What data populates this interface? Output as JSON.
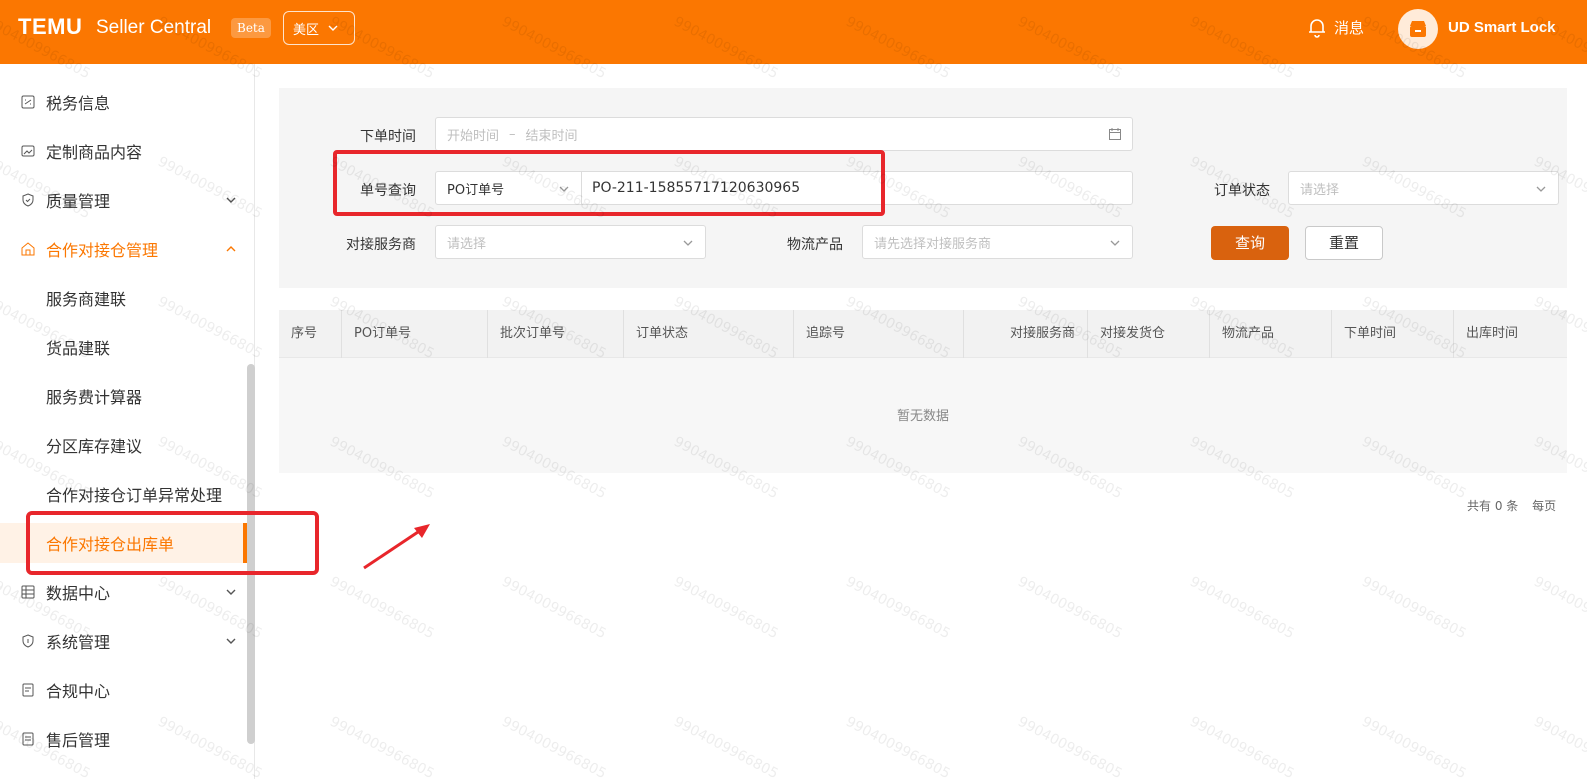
{
  "header": {
    "logo": "TEMU",
    "product": "Seller Central",
    "beta": "Beta",
    "region": "美区",
    "messages": "消息",
    "shop_name": "UD Smart Lock",
    "bg_color": "#fb7701"
  },
  "sidebar": {
    "items": [
      {
        "label": "税务信息",
        "icon": "tax-icon"
      },
      {
        "label": "定制商品内容",
        "icon": "image-icon"
      },
      {
        "label": "质量管理",
        "icon": "shield-icon",
        "expandable": true
      },
      {
        "label": "合作对接仓管理",
        "icon": "warehouse-icon",
        "expandable": true,
        "expanded": true
      },
      {
        "label": "数据中心",
        "icon": "data-icon",
        "expandable": true
      },
      {
        "label": "系统管理",
        "icon": "system-icon",
        "expandable": true
      },
      {
        "label": "合规中心",
        "icon": "compliance-icon"
      },
      {
        "label": "售后管理",
        "icon": "aftersale-icon"
      }
    ],
    "sub_items": [
      {
        "label": "服务商建联"
      },
      {
        "label": "货品建联"
      },
      {
        "label": "服务费计算器"
      },
      {
        "label": "分区库存建议"
      },
      {
        "label": "合作对接仓订单异常处理"
      },
      {
        "label": "合作对接仓出库单",
        "current": true
      }
    ]
  },
  "filters": {
    "order_time_label": "下单时间",
    "order_time_start": "开始时间",
    "order_time_sep": "–",
    "order_time_end": "结束时间",
    "order_no_label": "单号查询",
    "order_no_type": "PO订单号",
    "order_no_value": "PO-211-15855717120630965",
    "order_status_label": "订单状态",
    "order_status_placeholder": "请选择",
    "provider_label": "对接服务商",
    "provider_placeholder": "请选择",
    "logistics_label": "物流产品",
    "logistics_placeholder": "请先选择对接服务商",
    "query_button": "查询",
    "reset_button": "重置"
  },
  "table": {
    "columns": [
      "序号",
      "PO订单号",
      "批次订单号",
      "订单状态",
      "追踪号",
      "对接服务商",
      "对接发货仓",
      "物流产品",
      "下单时间",
      "出库时间"
    ],
    "empty_text": "暂无数据",
    "total_text": "共有 0 条",
    "per_page_text": "每页"
  },
  "watermark": "9904009966805"
}
